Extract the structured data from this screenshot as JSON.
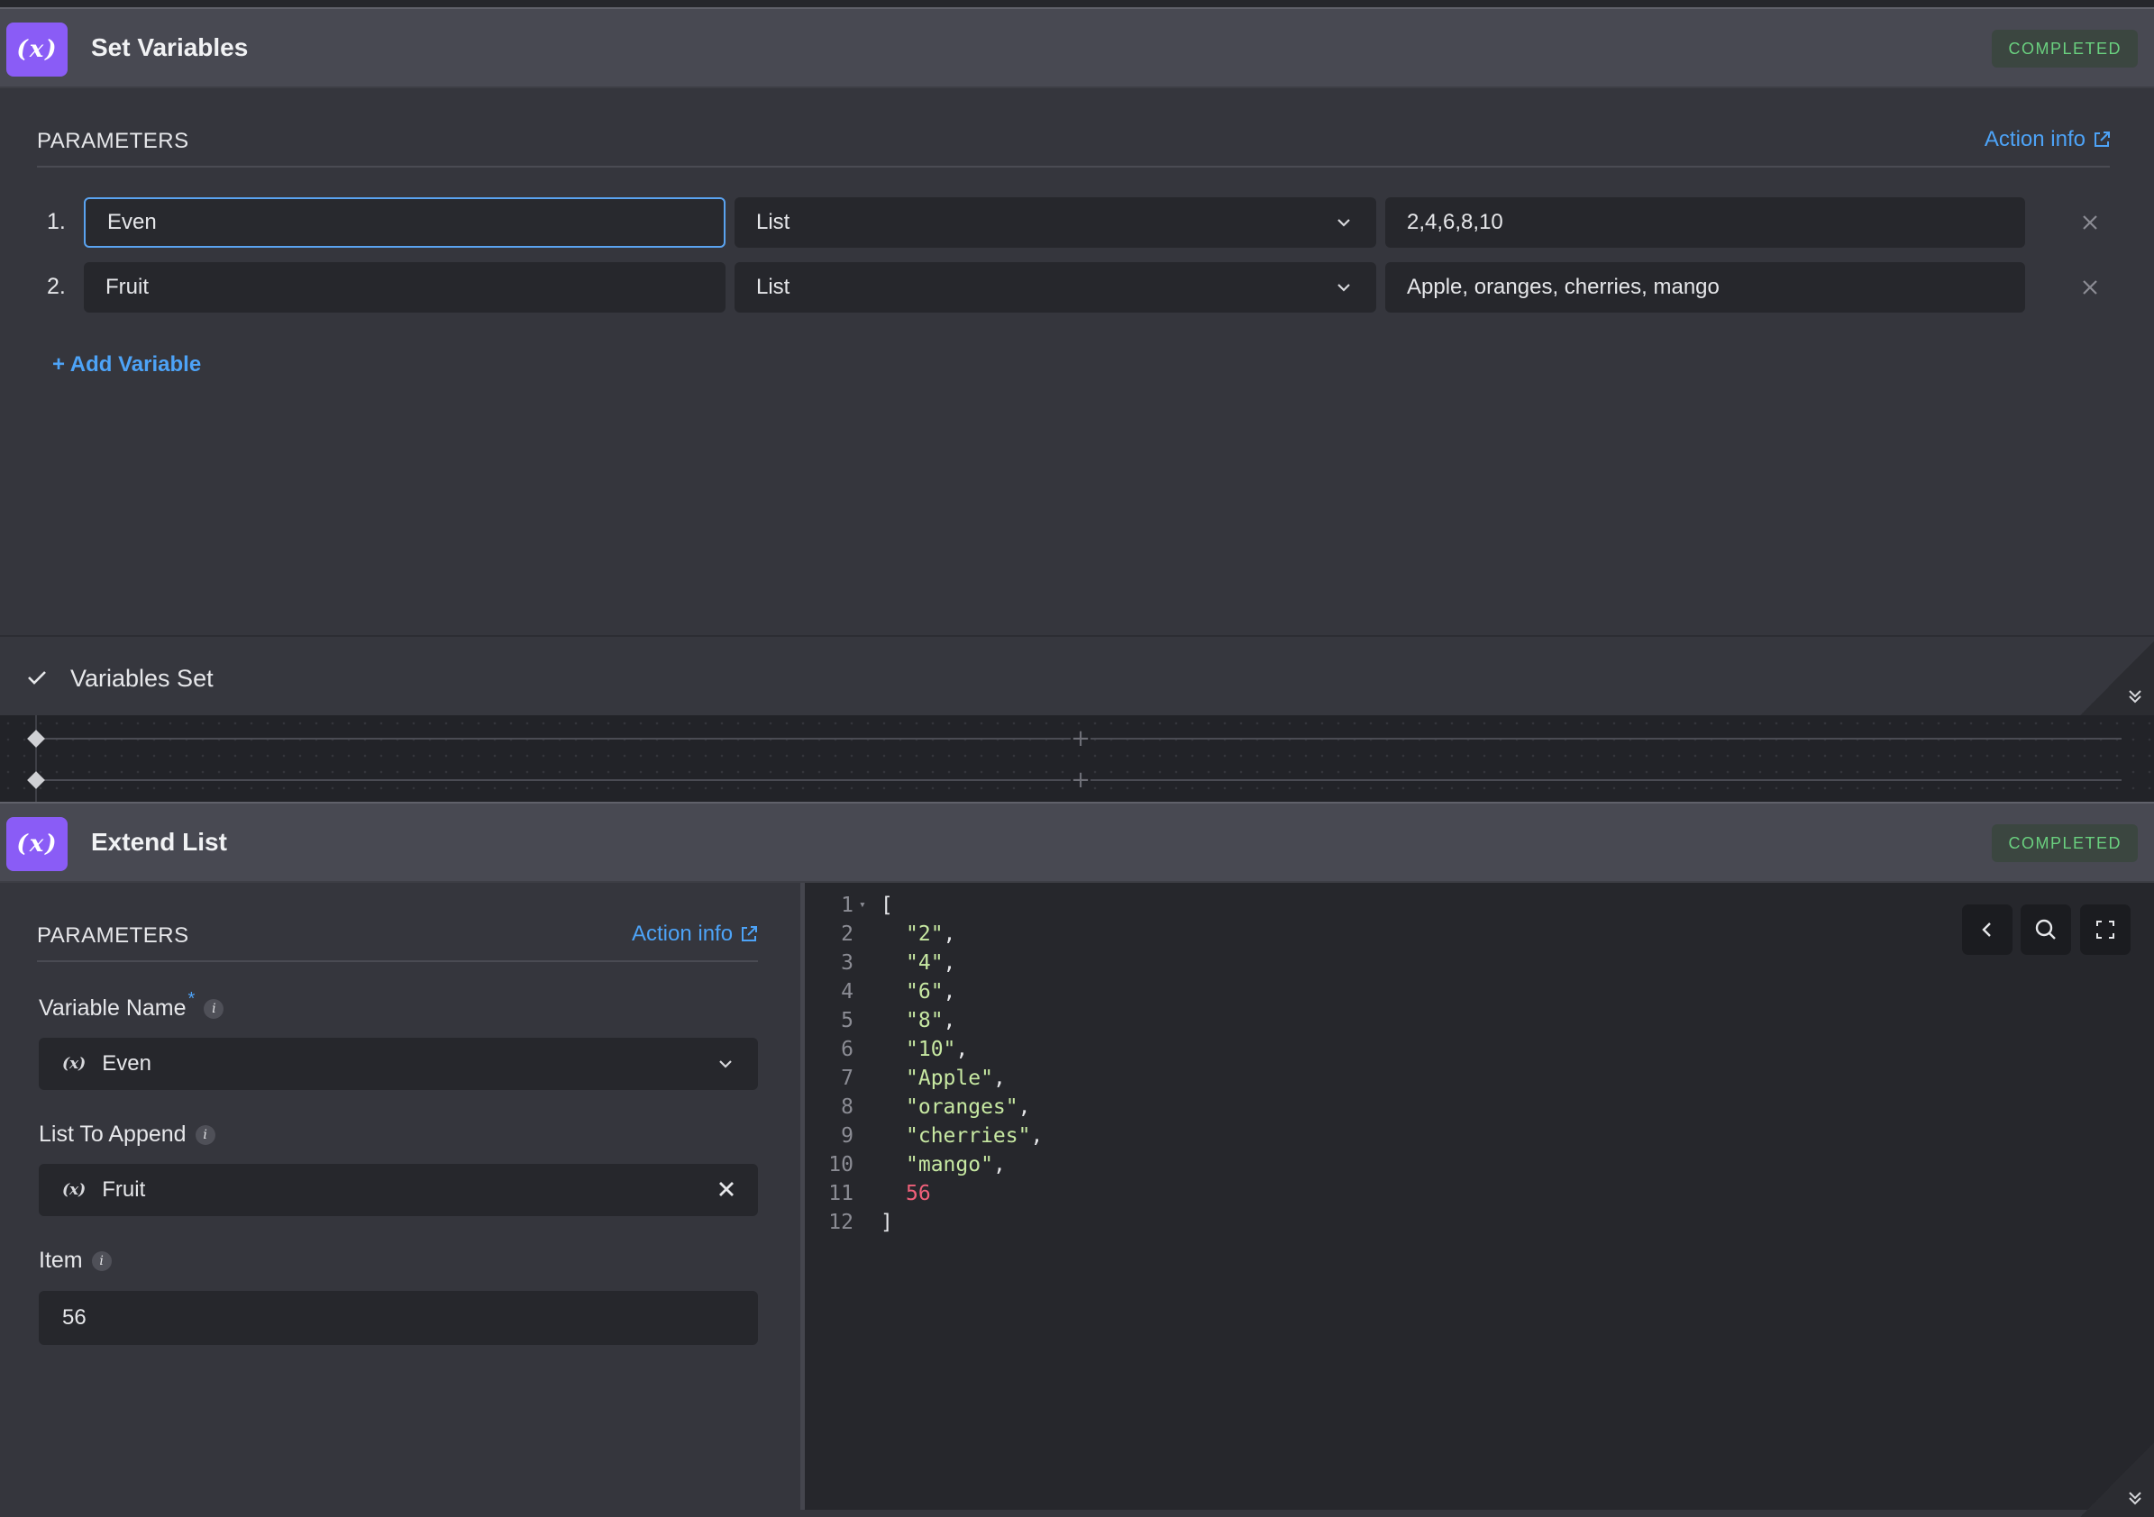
{
  "set_variables": {
    "title": "Set Variables",
    "status": "COMPLETED",
    "parameters_label": "PARAMETERS",
    "action_info": "Action info",
    "rows": [
      {
        "index": "1.",
        "name": "Even",
        "type": "List",
        "value": "2,4,6,8,10"
      },
      {
        "index": "2.",
        "name": "Fruit",
        "type": "List",
        "value": "Apple, oranges, cherries, mango"
      }
    ],
    "add_variable": "+ Add Variable",
    "footer_text": "Variables Set"
  },
  "extend_list": {
    "title": "Extend List",
    "status": "COMPLETED",
    "parameters_label": "PARAMETERS",
    "action_info": "Action info",
    "variable_name_label": "Variable Name",
    "required_mark": "*",
    "variable_name_value": "Even",
    "list_to_append_label": "List To Append",
    "list_to_append_value": "Fruit",
    "item_label": "Item",
    "item_value": "56",
    "fx_symbol": "(x)"
  },
  "code_output": {
    "lines": [
      {
        "n": "1",
        "text": "[",
        "kind": "punct",
        "indent": 0,
        "fold": true
      },
      {
        "n": "2",
        "text": "\"2\"",
        "kind": "str",
        "indent": 1,
        "comma": true
      },
      {
        "n": "3",
        "text": "\"4\"",
        "kind": "str",
        "indent": 1,
        "comma": true
      },
      {
        "n": "4",
        "text": "\"6\"",
        "kind": "str",
        "indent": 1,
        "comma": true
      },
      {
        "n": "5",
        "text": "\"8\"",
        "kind": "str",
        "indent": 1,
        "comma": true
      },
      {
        "n": "6",
        "text": "\"10\"",
        "kind": "str",
        "indent": 1,
        "comma": true
      },
      {
        "n": "7",
        "text": "\"Apple\"",
        "kind": "str",
        "indent": 1,
        "comma": true
      },
      {
        "n": "8",
        "text": "\"oranges\"",
        "kind": "str",
        "indent": 1,
        "comma": true
      },
      {
        "n": "9",
        "text": "\"cherries\"",
        "kind": "str",
        "indent": 1,
        "comma": true
      },
      {
        "n": "10",
        "text": "\"mango\"",
        "kind": "str",
        "indent": 1,
        "comma": true
      },
      {
        "n": "11",
        "text": "56",
        "kind": "num",
        "indent": 1
      },
      {
        "n": "12",
        "text": "]",
        "kind": "punct",
        "indent": 0
      }
    ]
  },
  "icons": {
    "badge": "fx-variable-icon",
    "external": "external-link-icon",
    "chevron": "chevron-down-icon",
    "remove": "close-icon",
    "check": "check-icon",
    "collapse": "double-chevron-down-icon",
    "back": "chevron-left-icon",
    "search": "search-icon",
    "fullscreen": "fullscreen-icon"
  },
  "colors": {
    "accent_purple": "#8a5cf6",
    "link_blue": "#4da3f7",
    "status_green": "#6ad07f",
    "string_green": "#c7e8a2",
    "number_red": "#f0607a"
  }
}
